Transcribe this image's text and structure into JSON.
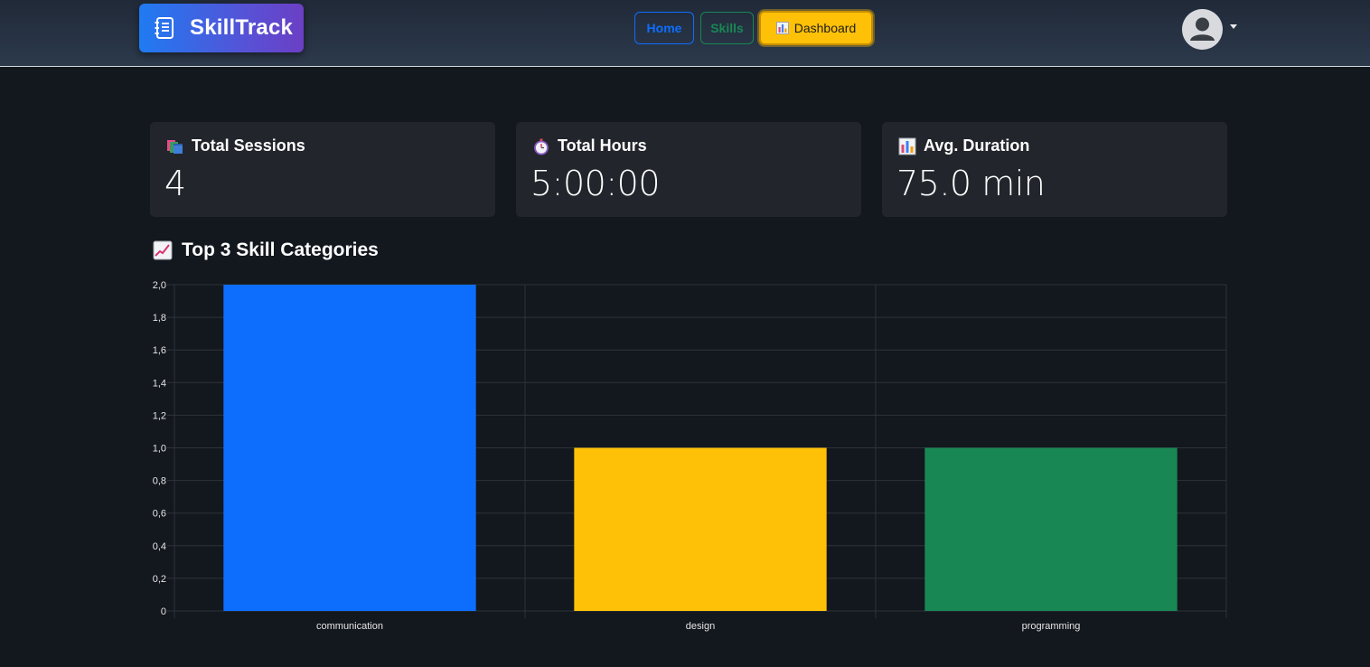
{
  "navbar": {
    "brand": "SkillTrack",
    "brand_icon": "notebook-icon",
    "links": [
      {
        "label": "Home",
        "color": "#0d6efd"
      },
      {
        "label": "Skills",
        "color": "#198754"
      },
      {
        "label": "Dashboard",
        "icon": "bar-chart-icon",
        "color": "#ffc107",
        "active": true
      }
    ],
    "user_icon": "user-avatar-icon"
  },
  "stats": [
    {
      "icon": "books-icon",
      "label": "Total Sessions",
      "value": "4"
    },
    {
      "icon": "stopwatch-icon",
      "label": "Total Hours",
      "value": "5:00:00"
    },
    {
      "icon": "bar-chart-icon",
      "label": "Avg. Duration",
      "value": "75.0 min"
    }
  ],
  "section": {
    "title": "Top 3 Skill Categories",
    "icon": "trending-up-icon"
  },
  "chart_data": {
    "type": "bar",
    "categories": [
      "communication",
      "design",
      "programming"
    ],
    "values": [
      2,
      1,
      1
    ],
    "colors": [
      "#0d6efd",
      "#ffc107",
      "#198754"
    ],
    "ylim": [
      0,
      2
    ],
    "yticks": [
      "0",
      "0,2",
      "0,4",
      "0,6",
      "0,8",
      "1,0",
      "1,2",
      "1,4",
      "1,6",
      "1,8",
      "2,0"
    ],
    "grid": true,
    "legend": false
  }
}
